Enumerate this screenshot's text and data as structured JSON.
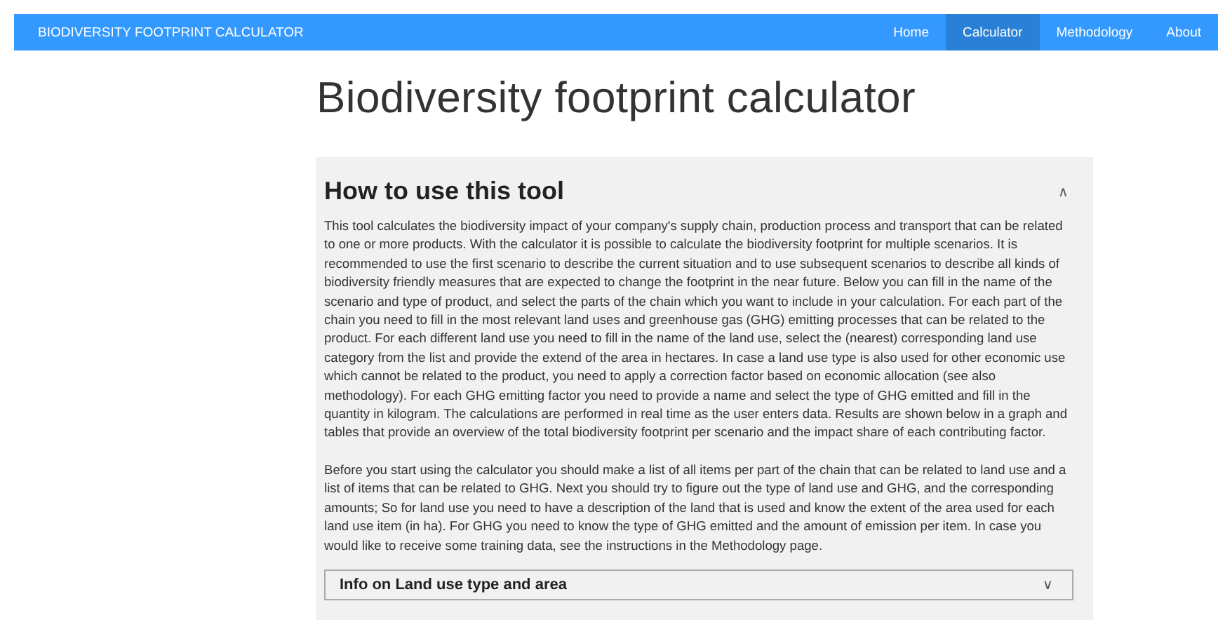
{
  "nav": {
    "brand": "BIODIVERSITY FOOTPRINT CALCULATOR",
    "items": [
      {
        "label": "Home",
        "selected": false
      },
      {
        "label": "Calculator",
        "selected": true
      },
      {
        "label": "Methodology",
        "selected": false
      },
      {
        "label": "About",
        "selected": false
      }
    ]
  },
  "title": "Biodiversity footprint calculator",
  "sections": [
    {
      "title": "How to use this tool",
      "expanded": true,
      "toggle": "∧",
      "paragraphs": [
        "This tool calculates the biodiversity impact of your company's supply chain, production process and transport that can be related to one or more products. With the calculator it is possible to calculate the biodiversity footprint for multiple scenarios. It is recommended to use the first scenario to describe the current situation and to use subsequent scenarios to describe all kinds of biodiversity friendly measures that are expected to change the footprint in the near future. Below you can fill in the name of the scenario and type of product, and select the parts of the chain which you want to include in your calculation. For each part of the chain you need to fill in the most relevant land uses and greenhouse gas (GHG) emitting processes that can be related to the product. For each different land use you need to fill in the name of the land use, select the (nearest) corresponding land use category from the list and provide the extend of the area in hectares. In case a land use type is also used for other economic use which cannot be related to the product, you need to apply a correction factor based on economic allocation (see also methodology). For each GHG emitting factor you need to provide a name and select the type of GHG emitted and fill in the quantity in kilogram. The calculations are performed in real time as the user enters data. Results are shown below in a graph and tables that provide an overview of the total biodiversity footprint per scenario and the impact share of each contributing factor.",
        "Before you start using the calculator you should make a list of all items per part of the chain that can be related to land use and a list of items that can be related to GHG. Next you should try to figure out the type of land use and GHG, and the corresponding amounts; So for land use you need to have a description of the land that is used and know the extent of the area used for each land use item (in ha). For GHG you need to know the type of GHG emitted and the amount of emission per item. In case you would like to receive some training data, see the instructions in the Methodology page."
      ]
    },
    {
      "title": "Info on Land use type and area",
      "expanded": false,
      "toggle": "∨"
    }
  ]
}
